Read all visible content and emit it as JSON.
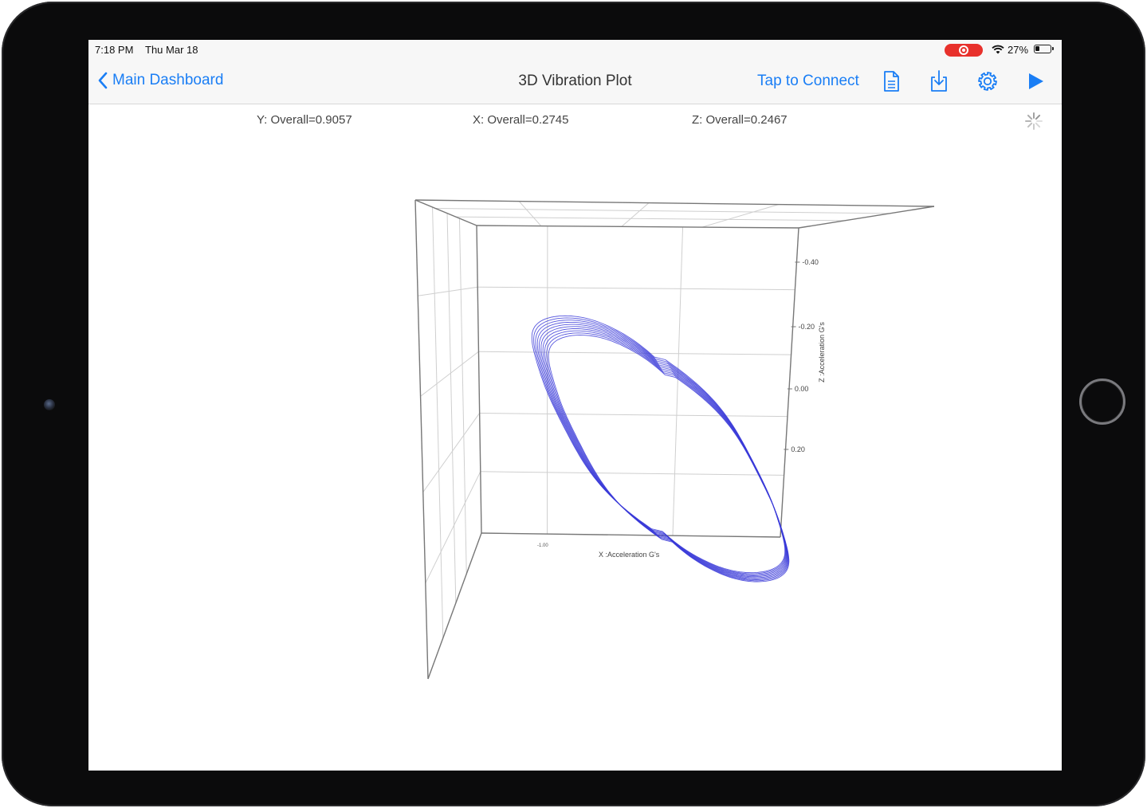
{
  "status": {
    "time": "7:18 PM",
    "date": "Thu Mar 18",
    "battery_pct": "27%",
    "battery_level": 0.27,
    "recording_indicator": "screen-recording",
    "wifi_icon": "wifi-icon"
  },
  "nav": {
    "back_label": "Main Dashboard",
    "title": "3D Vibration Plot",
    "connect_label": "Tap to Connect",
    "icons": [
      "document-icon",
      "download-icon",
      "gear-icon",
      "play-icon"
    ],
    "accent_color": "#1a7ef5"
  },
  "readouts": {
    "y": "Y: Overall=0.9057",
    "x": "X: Overall=0.2745",
    "z": "Z: Overall=0.2467"
  },
  "chart_data": {
    "type": "line",
    "projection": "3d",
    "series_color": "#3a3ad8",
    "z_axis": {
      "label": "Z :Acceleration G's",
      "ticks": [
        "-0.40",
        "-0.20",
        "0.00",
        "0.20"
      ]
    },
    "x_axis": {
      "label": "X :Acceleration G's",
      "ticks": [
        "-1.00"
      ]
    },
    "orbit": {
      "loops": 10,
      "x_range": [
        -1.0,
        1.0
      ],
      "z_range": [
        -0.3,
        0.4
      ]
    },
    "grid": true
  }
}
